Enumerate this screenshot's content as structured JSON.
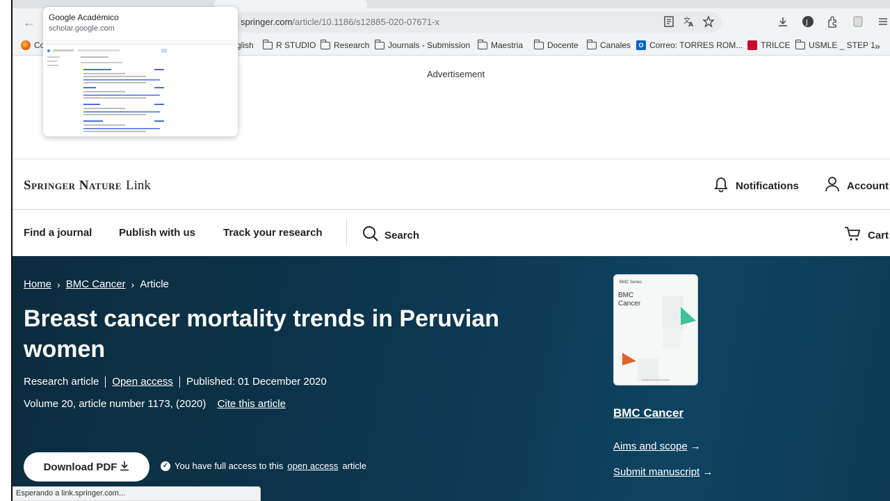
{
  "browser": {
    "url_host": "springer.com",
    "url_path": "/article/10.1186/s12885-020-07671-x",
    "status_text": "Esperando a link.springer.com...",
    "tab_preview": {
      "title": "Google Académico",
      "url": "scholar.google.com"
    },
    "bookmarks": [
      {
        "label": "Co",
        "icon": "firefox-icon"
      },
      {
        "label": "glish",
        "icon": ""
      },
      {
        "label": "R STUDIO",
        "icon": "folder-icon"
      },
      {
        "label": "Research",
        "icon": "folder-icon"
      },
      {
        "label": "Journals - Submission",
        "icon": "folder-icon"
      },
      {
        "label": "Maestria",
        "icon": "folder-icon"
      },
      {
        "label": "Docente",
        "icon": "folder-icon"
      },
      {
        "label": "Canales",
        "icon": "folder-icon"
      },
      {
        "label": "Correo: TORRES ROM...",
        "icon": "outlook-icon"
      },
      {
        "label": "TRILCE",
        "icon": "trilce-icon"
      },
      {
        "label": "USMLE _ STEP 1",
        "icon": "folder-icon"
      }
    ]
  },
  "page": {
    "ad_label": "Advertisement",
    "brand": {
      "name": "Springer Nature",
      "suffix": "Link"
    },
    "header": {
      "notifications": "Notifications",
      "account": "Account"
    },
    "nav": {
      "find_journal": "Find a journal",
      "publish": "Publish with us",
      "track": "Track your research",
      "search": "Search",
      "cart": "Cart"
    },
    "breadcrumbs": [
      "Home",
      "BMC Cancer",
      "Article"
    ],
    "article": {
      "title": "Breast cancer mortality trends in Peruvian women",
      "type": "Research article",
      "access": "Open access",
      "published": "Published: 01 December 2020",
      "volume": "Volume 20, article number 1173, (2020)",
      "cite": "Cite this article"
    },
    "download_label": "Download PDF",
    "access_note": {
      "prefix": "You have full access to this",
      "link": "open access",
      "suffix": "article"
    },
    "journal": {
      "cover_series": "BMC Series",
      "cover_name": "BMC\nCancer",
      "name": "BMC Cancer",
      "aims": "Aims and scope",
      "submit": "Submit manuscript"
    },
    "colors": {
      "hero": "#0d3650",
      "cover_green": "#3cc39a",
      "cover_orange": "#e2622b"
    }
  }
}
